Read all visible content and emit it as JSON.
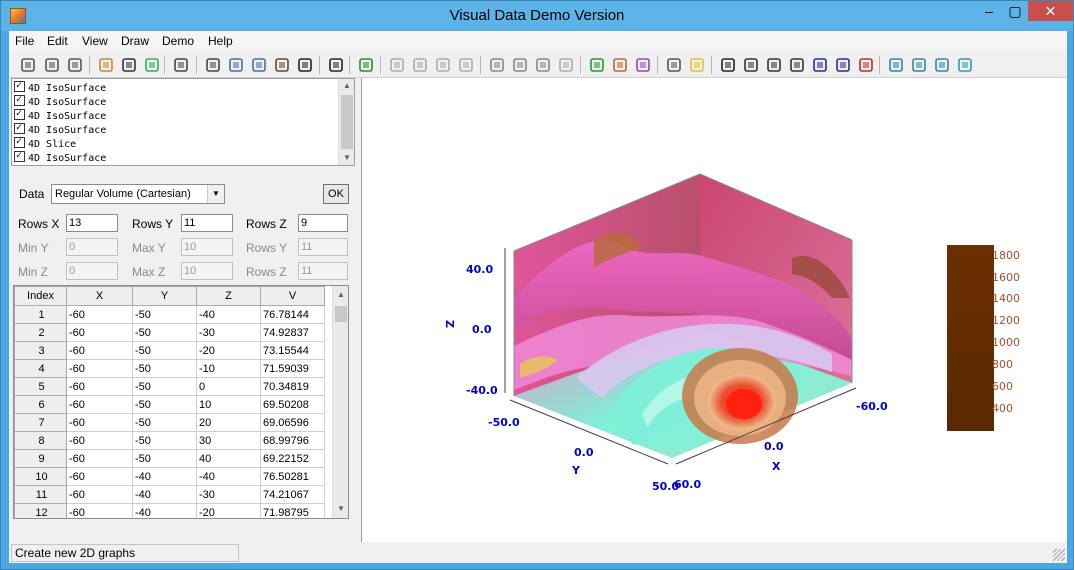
{
  "window": {
    "title": "Visual Data Demo Version"
  },
  "menu": [
    "File",
    "Edit",
    "View",
    "Draw",
    "Demo",
    "Help"
  ],
  "toolbar_icons": [
    "new-icon",
    "new-2d-icon",
    "new-3d-icon",
    "open-icon",
    "save-icon",
    "save-as-icon",
    "print-icon",
    "cut-icon",
    "copy-icon",
    "paste-special-icon",
    "paste-icon",
    "delete-icon",
    "help-icon",
    "points-icon",
    "mesh-icon",
    "wire-icon",
    "surface-icon",
    "solid-icon",
    "block-icon",
    "blob-icon",
    "grid-icon",
    "cone-icon",
    "scatter-icon",
    "stack-icon",
    "layers-icon",
    "table-icon",
    "bulb-icon",
    "move-icon",
    "zoom-in-icon",
    "zoom-out-icon",
    "rotate-icon",
    "rotate-x-icon",
    "rotate-y-icon",
    "rotate-z-icon",
    "cube-icon",
    "cube-2-icon",
    "cube-3-icon",
    "cube-4-icon"
  ],
  "layers": [
    {
      "label": "4D IsoSurface"
    },
    {
      "label": "4D IsoSurface"
    },
    {
      "label": "4D IsoSurface"
    },
    {
      "label": "4D IsoSurface"
    },
    {
      "label": "4D Slice"
    },
    {
      "label": "4D IsoSurface"
    }
  ],
  "data_panel": {
    "data_label": "Data",
    "data_type": "Regular Volume (Cartesian)",
    "ok_label": "OK",
    "rows_x_label": "Rows X",
    "rows_x": "13",
    "rows_y_label": "Rows Y",
    "rows_y": "11",
    "rows_z_label": "Rows Z",
    "rows_z": "9",
    "min_y_label": "Min Y",
    "min_y": "0",
    "max_y_label": "Max Y",
    "max_y": "10",
    "rows_y2_label": "Rows Y",
    "rows_y2": "11",
    "min_z_label": "Min Z",
    "min_z": "0",
    "max_z_label": "Max Z",
    "max_z": "10",
    "rows_z2_label": "Rows Z",
    "rows_z2": "11"
  },
  "table": {
    "headers": [
      "Index",
      "X",
      "Y",
      "Z",
      "V"
    ],
    "rows": [
      [
        "1",
        "-60",
        "-50",
        "-40",
        "76.78144"
      ],
      [
        "2",
        "-60",
        "-50",
        "-30",
        "74.92837"
      ],
      [
        "3",
        "-60",
        "-50",
        "-20",
        "73.15544"
      ],
      [
        "4",
        "-60",
        "-50",
        "-10",
        "71.59039"
      ],
      [
        "5",
        "-60",
        "-50",
        "0",
        "70.34819"
      ],
      [
        "6",
        "-60",
        "-50",
        "10",
        "69.50208"
      ],
      [
        "7",
        "-60",
        "-50",
        "20",
        "69.06596"
      ],
      [
        "8",
        "-60",
        "-50",
        "30",
        "68.99796"
      ],
      [
        "9",
        "-60",
        "-50",
        "40",
        "69.22152"
      ],
      [
        "10",
        "-60",
        "-40",
        "-40",
        "76.50281"
      ],
      [
        "11",
        "-60",
        "-40",
        "-30",
        "74.21067"
      ],
      [
        "12",
        "-60",
        "-40",
        "-20",
        "71.98795"
      ]
    ]
  },
  "plot": {
    "z_ticks": [
      "40.0",
      "0.0",
      "-40.0"
    ],
    "z_label": "Z",
    "y_ticks": [
      "-50.0",
      "0.0",
      "50.0"
    ],
    "y_label": "Y",
    "x_ticks": [
      "60.0",
      "0.0",
      "-60.0"
    ],
    "x_label": "X",
    "colorbar_ticks": [
      "1800",
      "1600",
      "1400",
      "1200",
      "1000",
      "800",
      "600",
      "400"
    ],
    "colors": {
      "box_back": "#d8508e",
      "cyan": "#7ff0d8",
      "red": "#f02a10",
      "colorbar": "#6b3000",
      "axis": "#0000cc"
    }
  },
  "status": {
    "text": "Create new 2D graphs"
  }
}
